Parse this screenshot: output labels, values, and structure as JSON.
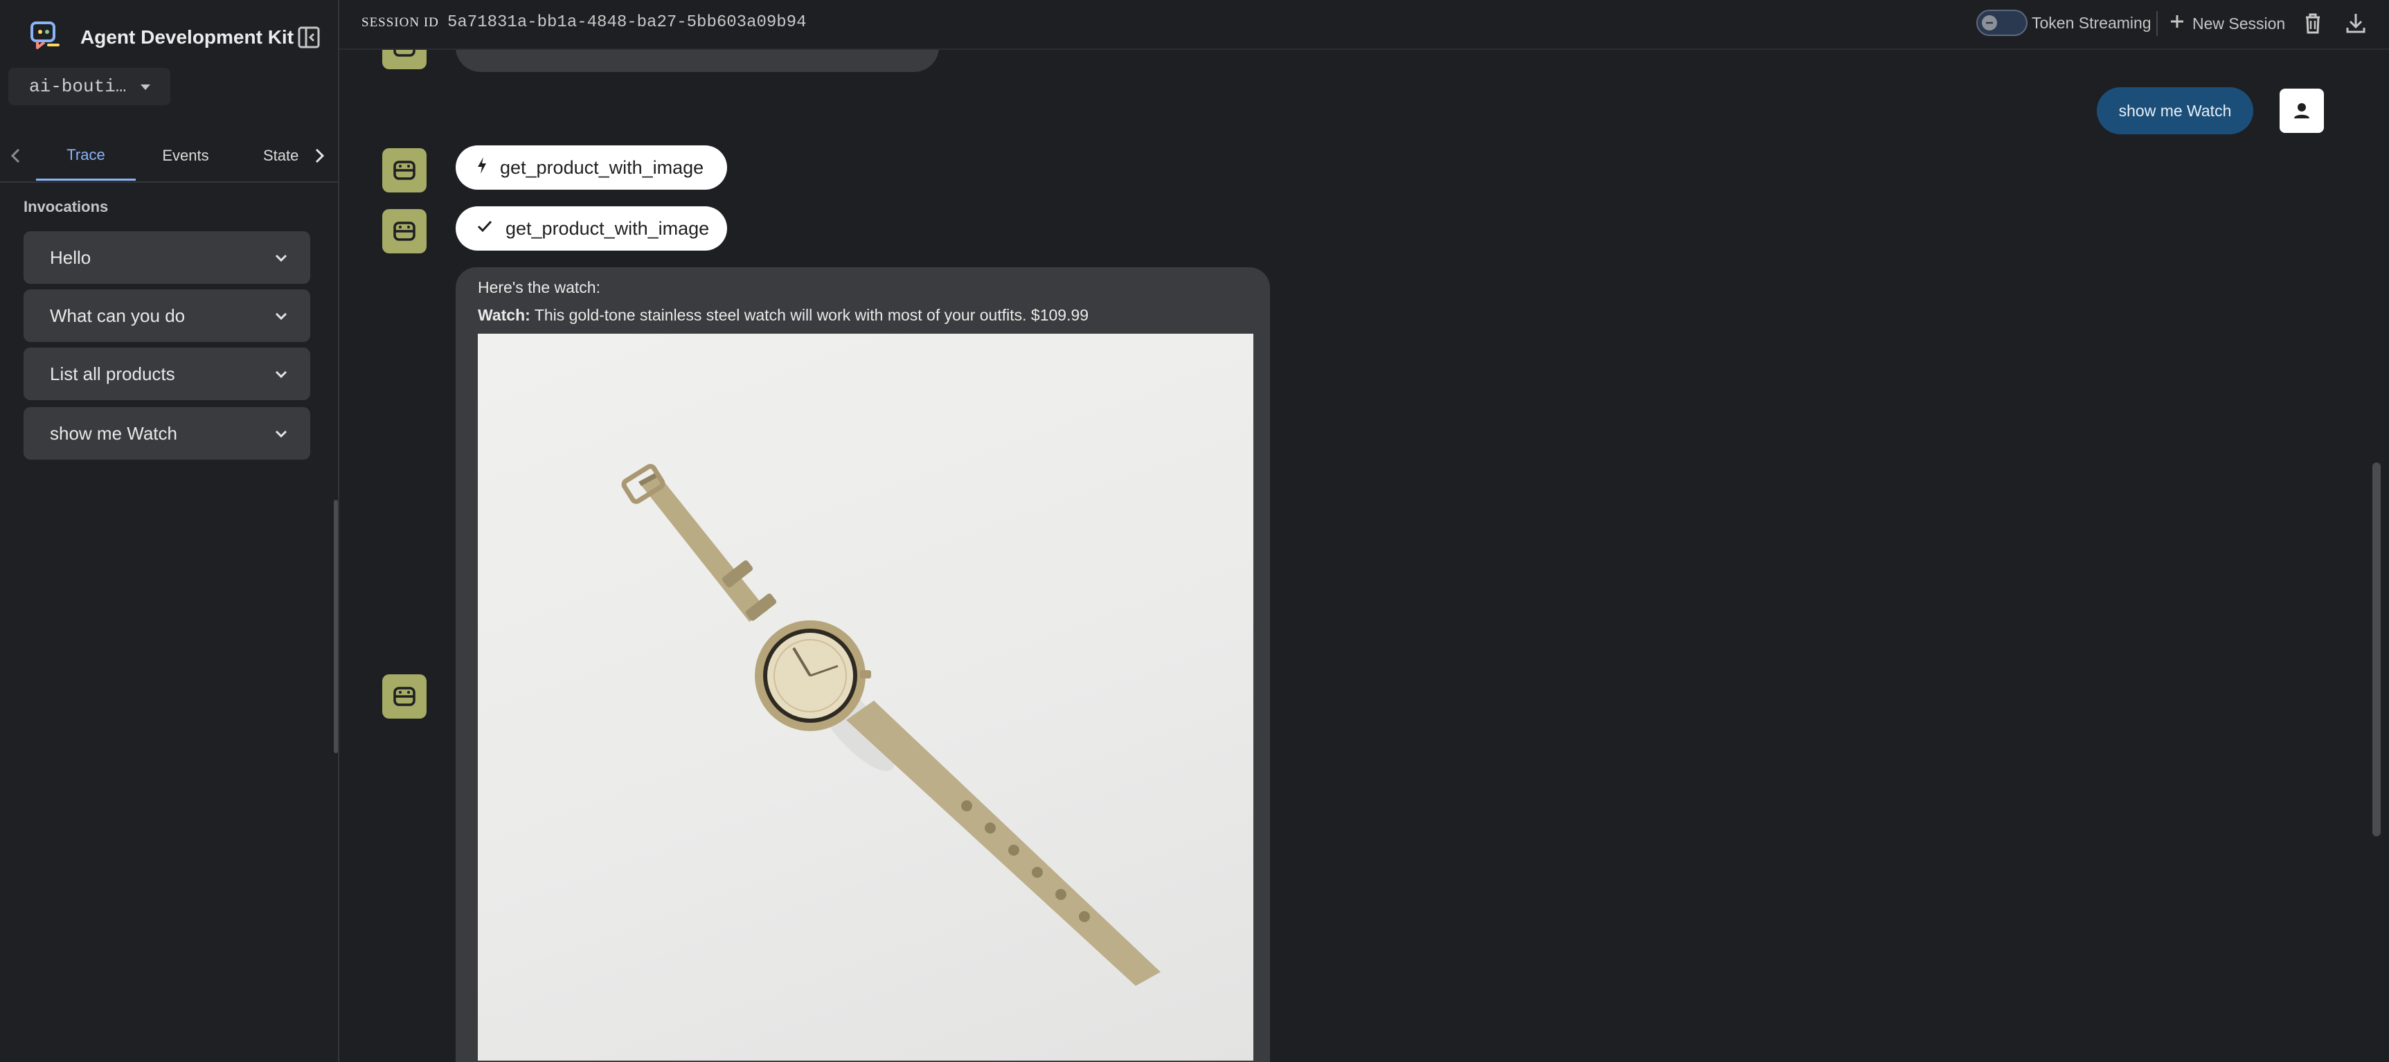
{
  "app": {
    "title": "Agent Development Kit",
    "selected_app": "ai-bouti…"
  },
  "sidebar": {
    "tabs": [
      {
        "label": "Trace",
        "active": true
      },
      {
        "label": "Events",
        "active": false
      },
      {
        "label": "State",
        "active": false
      }
    ],
    "invocations_heading": "Invocations",
    "invocations": [
      {
        "label": "Hello"
      },
      {
        "label": "What can you do"
      },
      {
        "label": "List all products"
      },
      {
        "label": "show me Watch"
      }
    ]
  },
  "header": {
    "session_label": "SESSION ID",
    "session_id": "5a71831a-bb1a-4848-ba27-5bb603a09b94",
    "token_streaming_label": "Token Streaming",
    "token_streaming_enabled": false,
    "new_session_label": "New Session"
  },
  "chat": {
    "user_message": "show me Watch",
    "function_call": {
      "name": "get_product_with_image",
      "icon": "bolt-icon"
    },
    "function_response": {
      "name": "get_product_with_image",
      "icon": "check-icon"
    },
    "agent_message": {
      "line1": "Here's the watch:",
      "product_label": "Watch:",
      "product_text": " This gold-tone stainless steel watch will work with most of your outfits. $109.99",
      "image_subject": "gold-tone mesh strap wristwatch"
    }
  },
  "colors": {
    "background": "#1e1f22",
    "accent": "#8ab4f8",
    "bot_avatar": "#a6ab66",
    "user_bubble": "#1b4f7a"
  }
}
